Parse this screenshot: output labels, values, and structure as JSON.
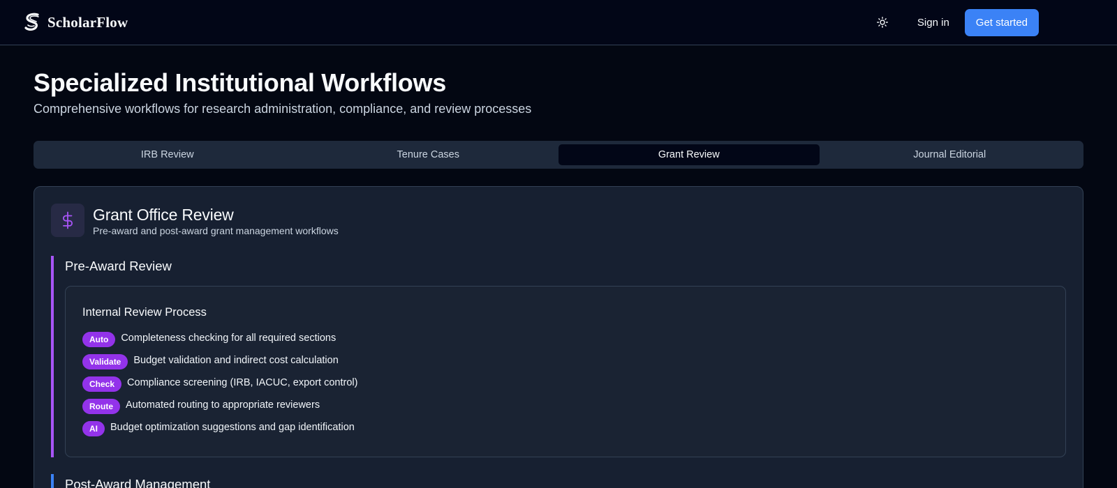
{
  "brand": {
    "name": "ScholarFlow"
  },
  "nav": {
    "signin": "Sign in",
    "get_started": "Get started"
  },
  "page": {
    "title": "Specialized Institutional Workflows",
    "subtitle": "Comprehensive workflows for research administration, compliance, and review processes"
  },
  "tabs": [
    {
      "label": "IRB Review",
      "active": false
    },
    {
      "label": "Tenure Cases",
      "active": false
    },
    {
      "label": "Grant Review",
      "active": true
    },
    {
      "label": "Journal Editorial",
      "active": false
    }
  ],
  "card": {
    "icon": "dollar-icon",
    "title": "Grant Office Review",
    "subtitle": "Pre-award and post-award grant management workflows",
    "sections": [
      {
        "title": "Pre-Award Review",
        "subcard_title": "Internal Review Process",
        "items": [
          {
            "badge": "Auto",
            "text": "Completeness checking for all required sections"
          },
          {
            "badge": "Validate",
            "text": "Budget validation and indirect cost calculation"
          },
          {
            "badge": "Check",
            "text": "Compliance screening (IRB, IACUC, export control)"
          },
          {
            "badge": "Route",
            "text": "Automated routing to appropriate reviewers"
          },
          {
            "badge": "AI",
            "text": "Budget optimization suggestions and gap identification"
          }
        ]
      },
      {
        "title": "Post-Award Management"
      }
    ]
  },
  "colors": {
    "accent": "#3b82f6",
    "purple": "#a855f7",
    "badge": "#9333ea",
    "background": "#030712"
  }
}
